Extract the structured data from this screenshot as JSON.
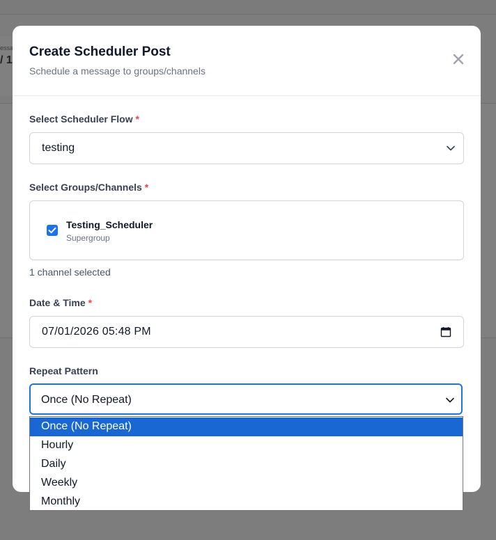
{
  "background": {
    "card_label": "essa",
    "card_value": "/ 1"
  },
  "modal": {
    "title": "Create Scheduler Post",
    "subtitle": "Schedule a message to groups/channels",
    "close_icon": "close-icon"
  },
  "flow": {
    "label": "Select Scheduler Flow",
    "required_mark": "*",
    "value": "testing"
  },
  "groups": {
    "label": "Select Groups/Channels",
    "required_mark": "*",
    "items": [
      {
        "name": "Testing_Scheduler",
        "type": "Supergroup",
        "checked": true
      }
    ],
    "selected_count": "1 channel selected"
  },
  "datetime": {
    "label": "Date & Time",
    "required_mark": "*",
    "value": "07/01/2026 05:48 PM"
  },
  "repeat": {
    "label": "Repeat Pattern",
    "value": "Once (No Repeat)",
    "options": [
      "Once (No Repeat)",
      "Hourly",
      "Daily",
      "Weekly",
      "Monthly"
    ],
    "selected_index": 0
  },
  "colors": {
    "accent": "#1a73e8",
    "selected_option": "#1967d2",
    "required": "#ef4444"
  }
}
